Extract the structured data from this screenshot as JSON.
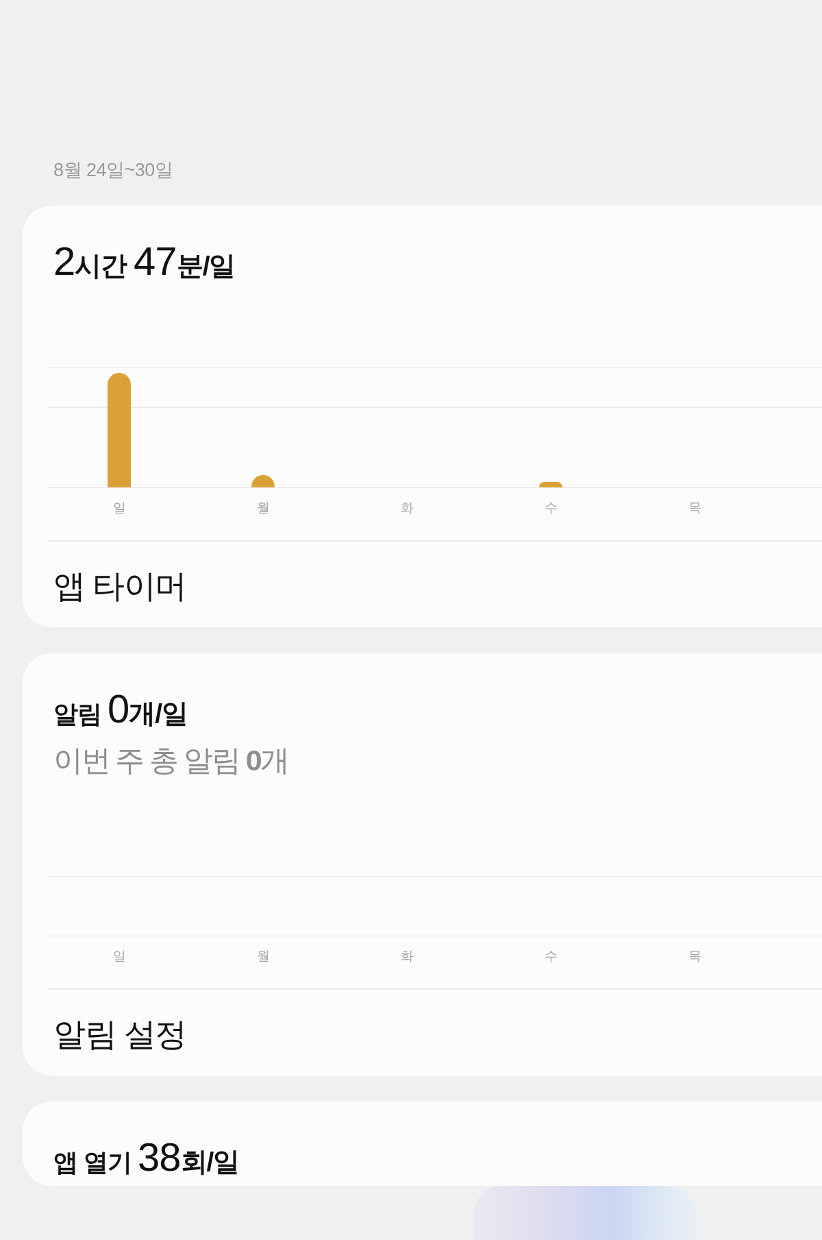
{
  "date_range": "8월 24일~30일",
  "cards": [
    {
      "headline": [
        {
          "text": "2",
          "kind": "number"
        },
        {
          "text": "시간 ",
          "kind": "unit"
        },
        {
          "text": "47",
          "kind": "number"
        },
        {
          "text": "분/일",
          "kind": "unit"
        }
      ],
      "chart": {
        "kind": "bars",
        "days": [
          "일",
          "월",
          "화",
          "수",
          "목"
        ]
      },
      "action": "앱 타이머"
    },
    {
      "headline": [
        {
          "text": "알림 ",
          "kind": "label"
        },
        {
          "text": "0",
          "kind": "number"
        },
        {
          "text": "개/일",
          "kind": "unit"
        }
      ],
      "subline": "이번 주 총 알림 **0**개",
      "chart": {
        "kind": "empty",
        "days": [
          "일",
          "월",
          "화",
          "수",
          "목"
        ]
      },
      "action": "알림 설정"
    },
    {
      "headline": [
        {
          "text": "앱 열기 ",
          "kind": "label"
        },
        {
          "text": "38",
          "kind": "number"
        },
        {
          "text": "회/일",
          "kind": "unit"
        }
      ]
    }
  ]
}
